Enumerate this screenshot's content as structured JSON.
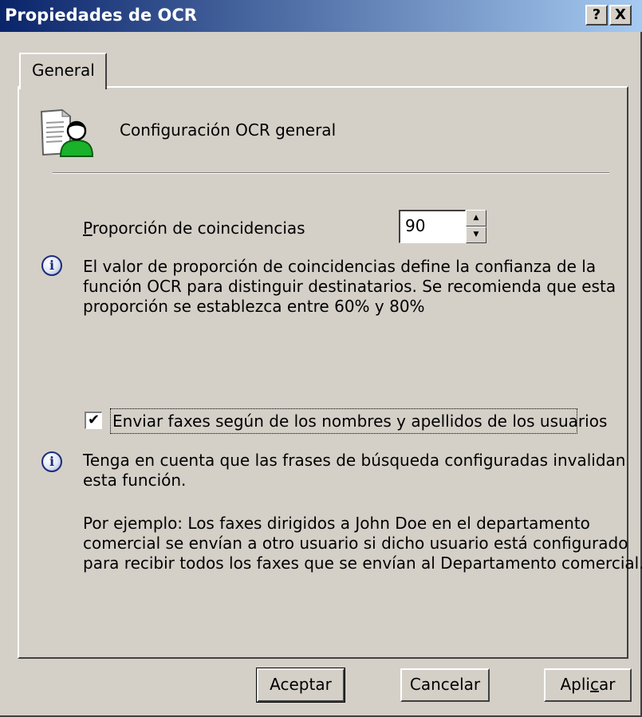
{
  "window": {
    "title": "Propiedades de OCR",
    "help_button": "?",
    "close_button": "X"
  },
  "tabs": [
    {
      "label": "General"
    }
  ],
  "header": {
    "icon": "user-document-icon",
    "title": "Configuración OCR general"
  },
  "match_ratio": {
    "label_rest": "roporción de coincidencias",
    "label_accel": "P",
    "value": "90",
    "info_icon": "info-icon",
    "info_lines": [
      "El valor de proporción de coincidencias define la confianza de la",
      "función OCR para distinguir destinatarios. Se recomienda que esta",
      "proporción se establezca entre 60% y 80%"
    ]
  },
  "send_by_name": {
    "checked": true,
    "check_glyph": "✔",
    "label": "Enviar faxes según de los nombres y apellidos de los usuarios",
    "info_icon": "info-icon",
    "info_lines": [
      "Tenga en cuenta que las frases de búsqueda configuradas invalidan",
      "esta función."
    ],
    "example_lines": [
      "Por ejemplo: Los faxes dirigidos a John Doe en el departamento",
      "comercial se envían a otro usuario si dicho usuario está configurado",
      "para recibir todos los faxes que se envían al Departamento comercial."
    ]
  },
  "buttons": {
    "ok": "Aceptar",
    "cancel": "Cancelar",
    "apply_before": "Apli",
    "apply_accel": "c",
    "apply_after": "ar"
  },
  "colors": {
    "titlebar_start": "#0a246a",
    "titlebar_end": "#a6caf0",
    "face": "#d4d0c8"
  }
}
